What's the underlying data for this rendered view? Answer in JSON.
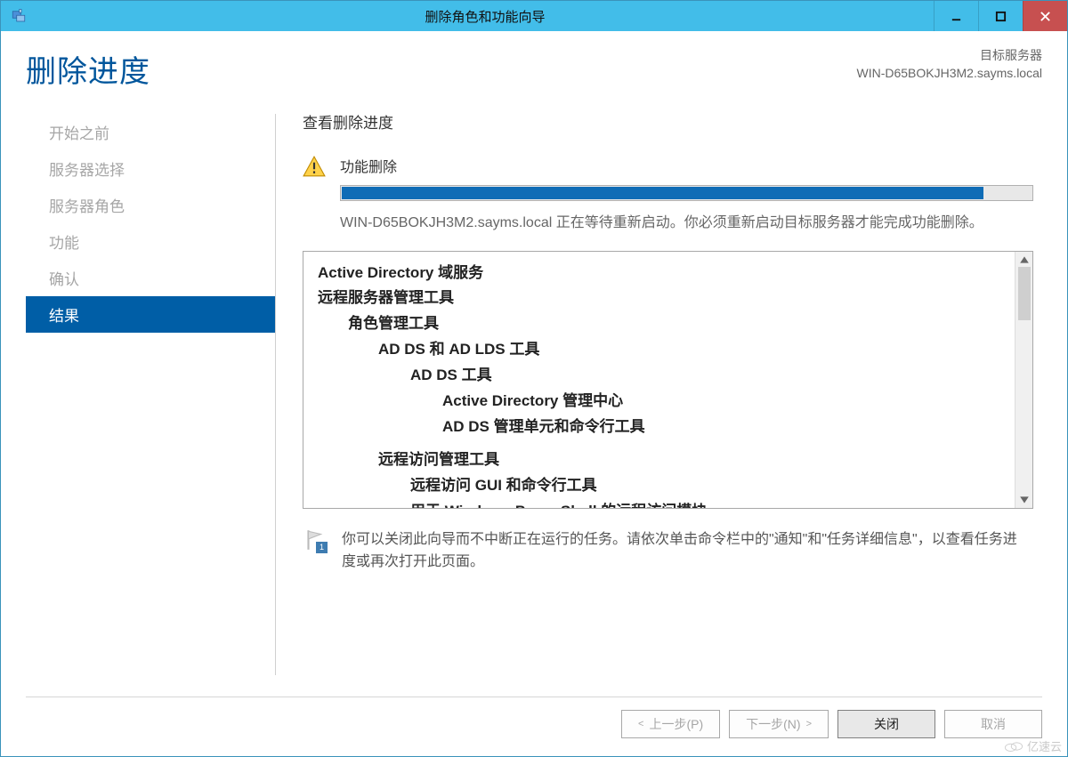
{
  "window": {
    "title": "删除角色和功能向导"
  },
  "header": {
    "page_title": "删除进度",
    "target_label": "目标服务器",
    "target_server": "WIN-D65BOKJH3M2.sayms.local"
  },
  "nav": {
    "items": [
      {
        "label": "开始之前",
        "selected": false
      },
      {
        "label": "服务器选择",
        "selected": false
      },
      {
        "label": "服务器角色",
        "selected": false
      },
      {
        "label": "功能",
        "selected": false
      },
      {
        "label": "确认",
        "selected": false
      },
      {
        "label": "结果",
        "selected": true
      }
    ]
  },
  "main": {
    "subheading": "查看删除进度",
    "status_title": "功能删除",
    "status_message": "WIN-D65BOKJH3M2.sayms.local 正在等待重新启动。你必须重新启动目标服务器才能完成功能删除。",
    "progress_percent": 93,
    "results": [
      {
        "level": 1,
        "text": "Active Directory 域服务"
      },
      {
        "level": 1,
        "text": "远程服务器管理工具"
      },
      {
        "level": 2,
        "text": "角色管理工具"
      },
      {
        "level": 3,
        "text": "AD DS 和 AD LDS 工具"
      },
      {
        "level": 4,
        "text": "AD DS 工具"
      },
      {
        "level": 5,
        "text": "Active Directory 管理中心"
      },
      {
        "level": 5,
        "text": "AD DS 管理单元和命令行工具"
      },
      {
        "level": 0,
        "text": ""
      },
      {
        "level": 3,
        "text": "远程访问管理工具"
      },
      {
        "level": 4,
        "text": "远程访问 GUI 和命令行工具"
      },
      {
        "level": 4,
        "text": "用于 Windows PowerShell 的远程访问模块"
      }
    ],
    "note_badge": "1",
    "note_text": "你可以关闭此向导而不中断正在运行的任务。请依次单击命令栏中的\"通知\"和\"任务详细信息\"，以查看任务进度或再次打开此页面。"
  },
  "footer": {
    "prev": "上一步(P)",
    "next": "下一步(N)",
    "close": "关闭",
    "cancel": "取消"
  },
  "watermark": "亿速云"
}
